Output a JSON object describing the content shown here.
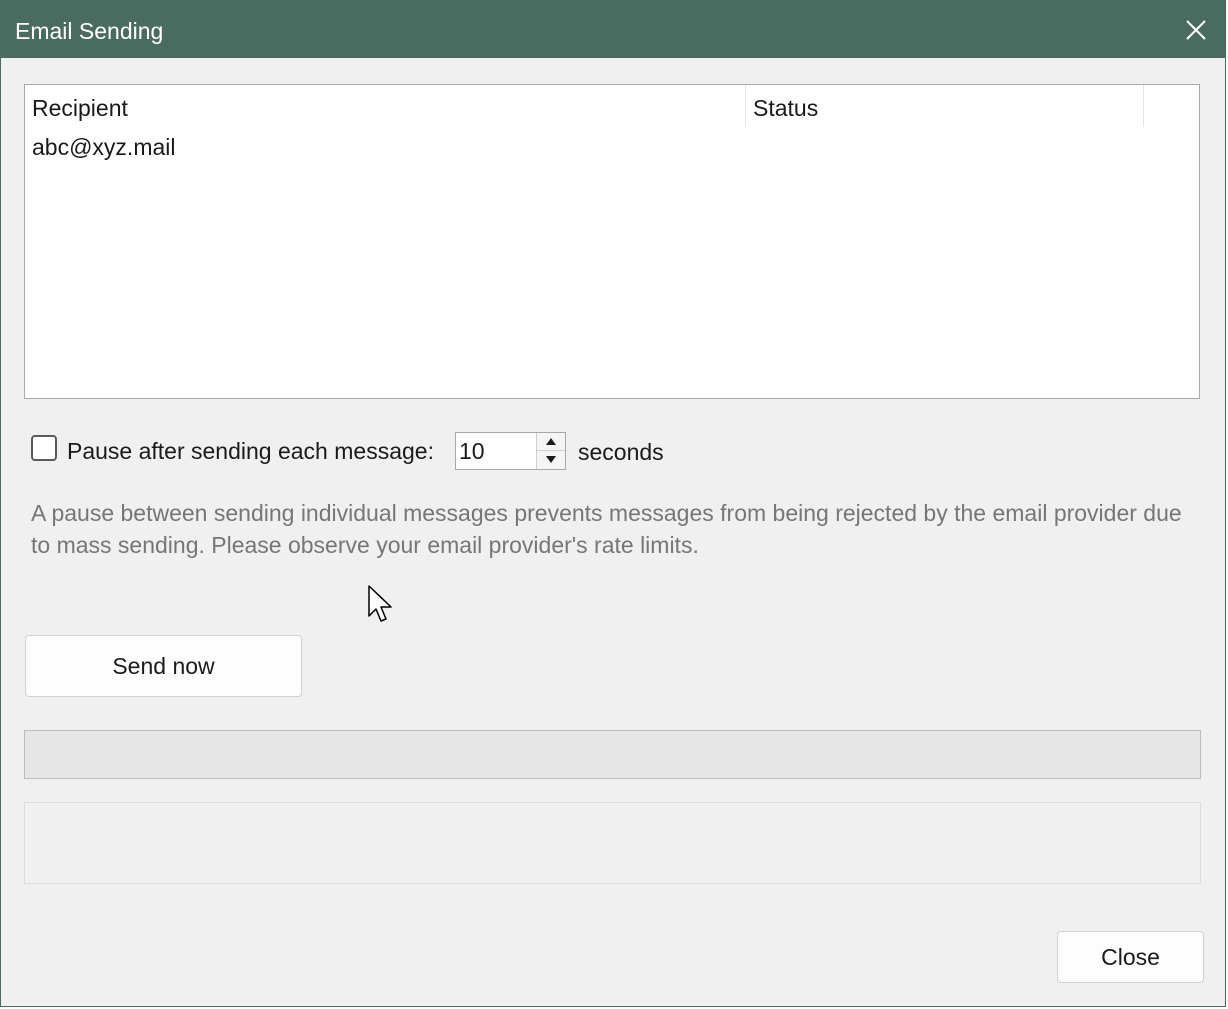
{
  "window": {
    "title": "Email Sending",
    "titlebar_color": "#4a6b60"
  },
  "recipients_list": {
    "columns": [
      "Recipient",
      "Status",
      ""
    ],
    "rows": [
      {
        "recipient": "abc@xyz.mail",
        "status": ""
      }
    ]
  },
  "pause_option": {
    "checked": false,
    "label": "Pause after sending each message:",
    "value": "10",
    "unit_label": "seconds"
  },
  "hint_text": "A pause between sending individual messages prevents messages from being rejected by the email provider due to mass sending. Please observe your email provider's rate limits.",
  "send_button_label": "Send now",
  "progress": {
    "fraction": 0
  },
  "status_text": "",
  "close_button_label": "Close",
  "icons": {
    "window_close": "close-icon",
    "spin_up": "chevron-up-icon",
    "spin_down": "chevron-down-icon",
    "pointer": "mouse-pointer-icon"
  }
}
